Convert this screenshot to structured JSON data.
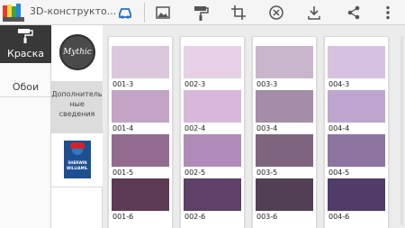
{
  "header": {
    "title": "3D-конструкто...",
    "icons": [
      "app-logo",
      "car-icon",
      "image-icon",
      "paint-roller-icon",
      "crop-icon",
      "cancel-icon",
      "download-icon",
      "share-icon",
      "more-vert-icon"
    ]
  },
  "tabs": [
    {
      "label": "Краска",
      "active": true
    },
    {
      "label": "Обои",
      "active": false
    }
  ],
  "brands": {
    "mythic": "Mythic",
    "more_info": "Дополнитель ные сведения",
    "sherwin_line1": "SHERWIN",
    "sherwin_line2": "WILLIAMS."
  },
  "swatches": [
    [
      {
        "code": "001-3",
        "color": "#dcc8dd"
      },
      {
        "code": "001-4",
        "color": "#c4a3c6"
      },
      {
        "code": "001-5",
        "color": "#946b90"
      },
      {
        "code": "001-6",
        "color": "#5e3b55"
      }
    ],
    [
      {
        "code": "002-3",
        "color": "#e6d1e7"
      },
      {
        "code": "002-4",
        "color": "#d8b7da"
      },
      {
        "code": "002-5",
        "color": "#b18bb7"
      },
      {
        "code": "002-6",
        "color": "#5e4068"
      }
    ],
    [
      {
        "code": "003-3",
        "color": "#c9b6cc"
      },
      {
        "code": "003-4",
        "color": "#a58ca8"
      },
      {
        "code": "003-5",
        "color": "#7f6480"
      },
      {
        "code": "003-6",
        "color": "#533f55"
      }
    ],
    [
      {
        "code": "004-3",
        "color": "#d6c2e0"
      },
      {
        "code": "004-4",
        "color": "#bea5cd"
      },
      {
        "code": "004-5",
        "color": "#8e74a1"
      },
      {
        "code": "004-6",
        "color": "#513b68"
      }
    ]
  ],
  "colors": {
    "active_tab": "#383838",
    "more_info_bg": "#dcdcdc",
    "sherwin_blue": "#1d4f91",
    "sherwin_red": "#d2232a"
  }
}
